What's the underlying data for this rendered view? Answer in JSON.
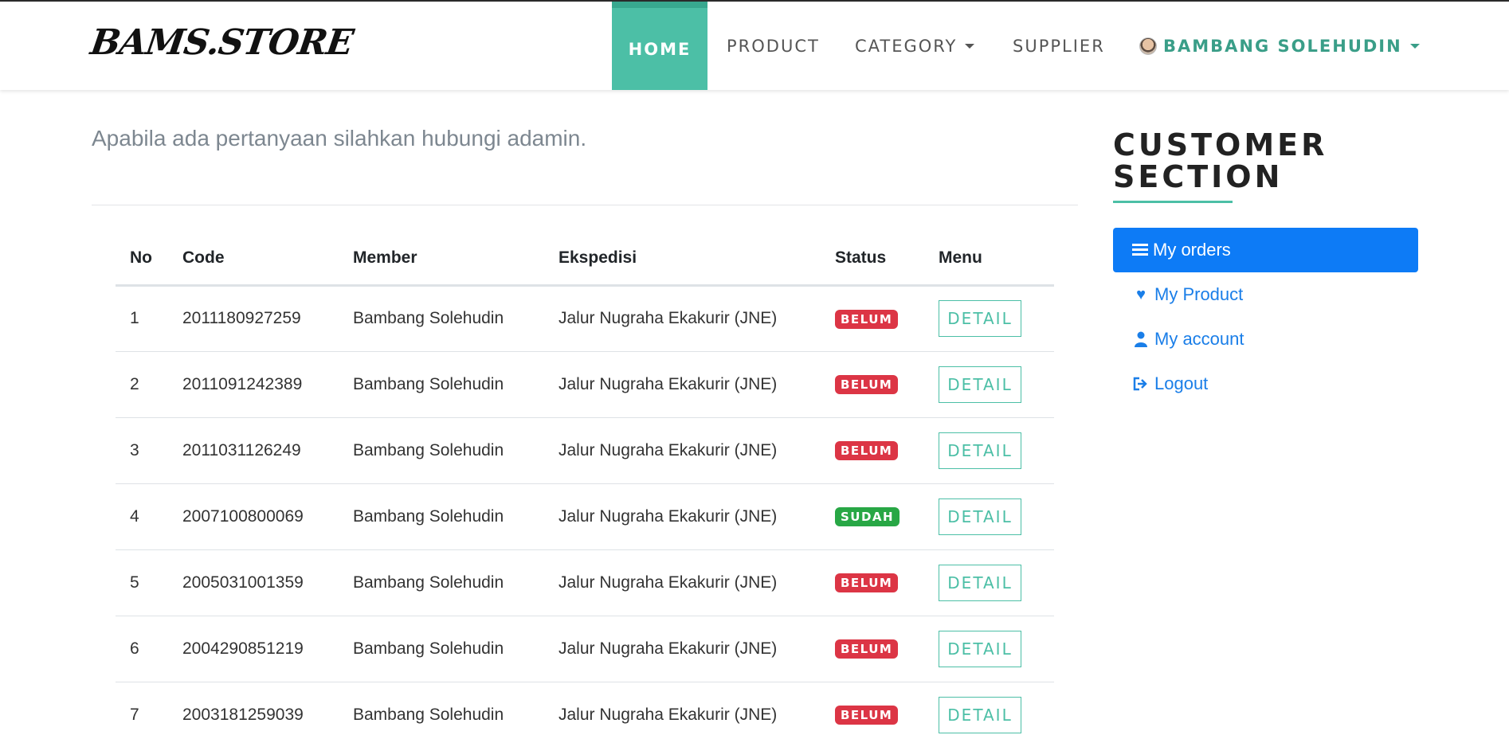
{
  "navbar": {
    "brand": "BAMS.STORE",
    "items": [
      {
        "label": "HOME"
      },
      {
        "label": "PRODUCT"
      },
      {
        "label": "CATEGORY"
      },
      {
        "label": "SUPPLIER"
      }
    ],
    "user": {
      "name": "BAMBANG SOLEHUDIN"
    }
  },
  "main": {
    "notice": "Apabila ada pertanyaan silahkan hubungi adamin.",
    "table": {
      "columns": [
        "No",
        "Code",
        "Member",
        "Ekspedisi",
        "Status",
        "Menu"
      ],
      "rows": [
        {
          "no": "1",
          "code": "2011180927259",
          "member": "Bambang Solehudin",
          "ekspedisi": "Jalur Nugraha Ekakurir (JNE)",
          "status": "BELUM",
          "action": "DETAIL"
        },
        {
          "no": "2",
          "code": "2011091242389",
          "member": "Bambang Solehudin",
          "ekspedisi": "Jalur Nugraha Ekakurir (JNE)",
          "status": "BELUM",
          "action": "DETAIL"
        },
        {
          "no": "3",
          "code": "2011031126249",
          "member": "Bambang Solehudin",
          "ekspedisi": "Jalur Nugraha Ekakurir (JNE)",
          "status": "BELUM",
          "action": "DETAIL"
        },
        {
          "no": "4",
          "code": "2007100800069",
          "member": "Bambang Solehudin",
          "ekspedisi": "Jalur Nugraha Ekakurir (JNE)",
          "status": "SUDAH",
          "action": "DETAIL"
        },
        {
          "no": "5",
          "code": "2005031001359",
          "member": "Bambang Solehudin",
          "ekspedisi": "Jalur Nugraha Ekakurir (JNE)",
          "status": "BELUM",
          "action": "DETAIL"
        },
        {
          "no": "6",
          "code": "2004290851219",
          "member": "Bambang Solehudin",
          "ekspedisi": "Jalur Nugraha Ekakurir (JNE)",
          "status": "BELUM",
          "action": "DETAIL"
        },
        {
          "no": "7",
          "code": "2003181259039",
          "member": "Bambang Solehudin",
          "ekspedisi": "Jalur Nugraha Ekakurir (JNE)",
          "status": "BELUM",
          "action": "DETAIL"
        }
      ]
    }
  },
  "sidebar": {
    "title_line1": "CUSTOMER",
    "title_line2": "SECTION",
    "menu": [
      {
        "label": "My orders",
        "icon": "list-icon"
      },
      {
        "label": "My Product",
        "icon": "heart-icon"
      },
      {
        "label": "My account",
        "icon": "user-icon"
      },
      {
        "label": "Logout",
        "icon": "sign-out-icon"
      }
    ]
  },
  "colors": {
    "accent": "#4cbfa6",
    "primary": "#0d7bf6",
    "status_belum": "#dc3545",
    "status_sudah": "#28a745"
  }
}
